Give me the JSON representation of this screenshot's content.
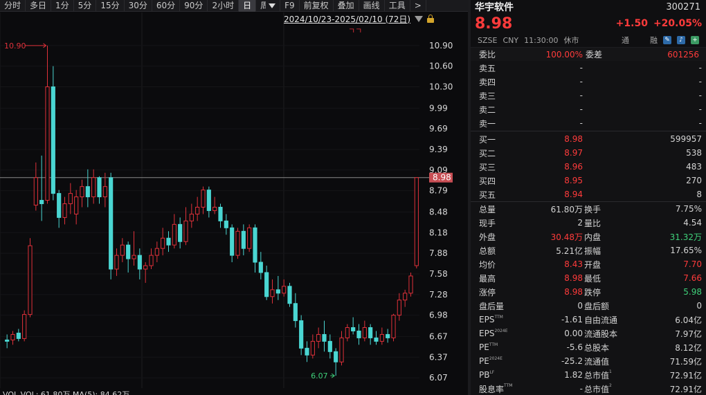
{
  "toolbar": {
    "items": [
      "分时",
      "多日",
      "1分",
      "5分",
      "15分",
      "30分",
      "60分",
      "90分",
      "2小时",
      "日",
      "周",
      "F9",
      "前复权",
      "叠加",
      "画线",
      "工具",
      ">"
    ],
    "active_index": 9
  },
  "chart": {
    "range": "2024/10/23-2025/02/10 (72日)",
    "price_labels": [
      "10.90",
      "10.60",
      "10.30",
      "9.99",
      "9.69",
      "9.39",
      "9.09",
      "8.79",
      "8.48",
      "8.18",
      "7.88",
      "7.58",
      "7.28",
      "6.98",
      "6.67",
      "6.37",
      "6.07"
    ],
    "current_price_tag": "8.98",
    "high_marker": "10.90",
    "low_marker": "6.07",
    "limit_up_marker": "ㄱㄱ",
    "bottom_text": "VOL    VOL: 61.80万    MA(5): 84.62万",
    "colors": {
      "up": "#e0313a",
      "down": "#4ad6d2",
      "background": "#0b0b0d"
    }
  },
  "chart_data": {
    "type": "candlestick",
    "ylim": [
      5.9,
      11.2
    ],
    "candles": [
      [
        6.62,
        6.6,
        6.7,
        6.5
      ],
      [
        6.62,
        6.7,
        6.75,
        6.55
      ],
      [
        6.72,
        6.64,
        6.78,
        6.6
      ],
      [
        6.64,
        6.99,
        7.05,
        6.6
      ],
      [
        6.99,
        7.99,
        8.1,
        6.95
      ],
      [
        8.58,
        8.98,
        9.2,
        8.5
      ],
      [
        8.65,
        8.6,
        9.3,
        8.35
      ],
      [
        8.65,
        10.3,
        10.9,
        8.6
      ],
      [
        10.3,
        8.75,
        10.6,
        8.65
      ],
      [
        8.75,
        8.4,
        8.8,
        8.25
      ],
      [
        8.4,
        8.6,
        8.7,
        8.3
      ],
      [
        8.6,
        8.75,
        8.9,
        8.45
      ],
      [
        8.45,
        8.7,
        8.8,
        8.3
      ],
      [
        8.7,
        8.85,
        8.95,
        8.55
      ],
      [
        8.85,
        8.7,
        9.1,
        8.55
      ],
      [
        8.7,
        8.98,
        9.1,
        8.6
      ],
      [
        8.98,
        8.7,
        9.0,
        8.6
      ],
      [
        8.7,
        8.85,
        9.05,
        8.55
      ],
      [
        8.98,
        7.65,
        9.05,
        7.5
      ],
      [
        7.65,
        7.85,
        7.95,
        7.55
      ],
      [
        7.85,
        8.0,
        8.1,
        7.75
      ],
      [
        8.0,
        7.8,
        8.05,
        7.6
      ],
      [
        7.8,
        7.85,
        8.2,
        7.7
      ],
      [
        7.85,
        7.65,
        7.95,
        7.5
      ],
      [
        7.65,
        7.7,
        7.75,
        7.45
      ],
      [
        7.7,
        7.85,
        7.95,
        7.65
      ],
      [
        7.85,
        7.95,
        8.05,
        7.75
      ],
      [
        7.95,
        8.1,
        8.25,
        7.85
      ],
      [
        8.1,
        8.0,
        8.2,
        7.9
      ],
      [
        8.0,
        8.3,
        8.45,
        7.95
      ],
      [
        8.3,
        8.05,
        8.4,
        7.95
      ],
      [
        8.05,
        8.35,
        8.55,
        8.0
      ],
      [
        8.35,
        8.45,
        8.6,
        8.25
      ],
      [
        8.45,
        8.55,
        8.7,
        8.35
      ],
      [
        8.55,
        8.8,
        8.85,
        8.45
      ],
      [
        8.8,
        8.5,
        8.85,
        8.4
      ],
      [
        8.5,
        8.55,
        8.7,
        8.45
      ],
      [
        8.55,
        8.35,
        8.6,
        8.25
      ],
      [
        8.35,
        8.25,
        8.45,
        8.15
      ],
      [
        8.25,
        7.85,
        8.3,
        7.75
      ],
      [
        7.85,
        8.2,
        8.25,
        7.8
      ],
      [
        8.2,
        7.95,
        8.3,
        7.85
      ],
      [
        7.95,
        8.25,
        8.3,
        7.9
      ],
      [
        8.25,
        7.75,
        8.3,
        7.6
      ],
      [
        7.75,
        7.6,
        7.9,
        7.5
      ],
      [
        7.6,
        7.25,
        7.7,
        7.2
      ],
      [
        7.25,
        7.35,
        7.5,
        7.15
      ],
      [
        7.35,
        7.3,
        7.55,
        7.2
      ],
      [
        7.3,
        7.4,
        7.5,
        7.25
      ],
      [
        7.4,
        7.15,
        7.45,
        7.1
      ],
      [
        7.15,
        6.9,
        7.3,
        6.8
      ],
      [
        6.9,
        6.5,
        6.98,
        6.4
      ],
      [
        6.5,
        6.4,
        6.6,
        6.3
      ],
      [
        6.4,
        6.6,
        6.7,
        6.35
      ],
      [
        6.6,
        6.7,
        6.8,
        6.5
      ],
      [
        6.7,
        6.6,
        6.9,
        6.45
      ],
      [
        6.6,
        6.45,
        6.7,
        6.35
      ],
      [
        6.45,
        6.3,
        6.5,
        6.1
      ],
      [
        6.3,
        6.65,
        6.75,
        6.25
      ],
      [
        6.65,
        6.8,
        6.85,
        6.6
      ],
      [
        6.8,
        6.75,
        6.95,
        6.7
      ],
      [
        6.75,
        6.65,
        6.85,
        6.55
      ],
      [
        6.65,
        6.8,
        6.9,
        6.6
      ],
      [
        6.8,
        6.65,
        6.85,
        6.55
      ],
      [
        6.65,
        6.6,
        6.75,
        6.55
      ],
      [
        6.6,
        6.7,
        6.8,
        6.55
      ],
      [
        6.7,
        6.65,
        6.78,
        6.58
      ],
      [
        6.65,
        6.98,
        7.0,
        6.6
      ],
      [
        6.98,
        7.2,
        7.3,
        6.9
      ],
      [
        7.2,
        7.3,
        7.35,
        7.1
      ],
      [
        7.3,
        7.55,
        7.6,
        7.25
      ],
      [
        7.7,
        8.98,
        8.98,
        7.66
      ]
    ]
  },
  "quote": {
    "name": "华宇软件",
    "code": "300271",
    "price": "8.98",
    "change": "+1.50",
    "change_pct": "+20.05%",
    "meta": {
      "exchange": "SZSE",
      "currency": "CNY",
      "time": "11:30:00",
      "status": "休市",
      "tong": "通",
      "rong": "融"
    },
    "wei": {
      "label1": "委比",
      "value1": "100.00%",
      "label2": "委差",
      "value2": "601256"
    },
    "asks": [
      {
        "label": "卖五",
        "price": "-",
        "vol": "-"
      },
      {
        "label": "卖四",
        "price": "-",
        "vol": "-"
      },
      {
        "label": "卖三",
        "price": "-",
        "vol": "-"
      },
      {
        "label": "卖二",
        "price": "-",
        "vol": "-"
      },
      {
        "label": "卖一",
        "price": "-",
        "vol": "-"
      }
    ],
    "bids": [
      {
        "label": "买一",
        "price": "8.98",
        "vol": "599957"
      },
      {
        "label": "买二",
        "price": "8.97",
        "vol": "538"
      },
      {
        "label": "买三",
        "price": "8.96",
        "vol": "483"
      },
      {
        "label": "买四",
        "price": "8.95",
        "vol": "270"
      },
      {
        "label": "买五",
        "price": "8.94",
        "vol": "8"
      }
    ],
    "stats": [
      {
        "k1": "总量",
        "v1": "61.80万",
        "k2": "换手",
        "v2": "7.75%",
        "c1": "",
        "c2": ""
      },
      {
        "k1": "现手",
        "v1": "2",
        "k2": "量比",
        "v2": "4.54",
        "c1": "",
        "c2": ""
      },
      {
        "k1": "外盘",
        "v1": "30.48万",
        "k2": "内盘",
        "v2": "31.32万",
        "c1": "red",
        "c2": "green"
      },
      {
        "k1": "总额",
        "v1": "5.21亿",
        "k2": "振幅",
        "v2": "17.65%",
        "c1": "",
        "c2": ""
      },
      {
        "k1": "均价",
        "v1": "8.43",
        "k2": "开盘",
        "v2": "7.70",
        "c1": "red",
        "c2": "red"
      },
      {
        "k1": "最高",
        "v1": "8.98",
        "k2": "最低",
        "v2": "7.66",
        "c1": "red",
        "c2": "red"
      },
      {
        "k1": "涨停",
        "v1": "8.98",
        "k2": "跌停",
        "v2": "5.98",
        "c1": "red",
        "c2": "green"
      },
      {
        "k1": "盘后量",
        "v1": "0",
        "k2": "盘后额",
        "v2": "0",
        "c1": "",
        "c2": ""
      },
      {
        "k1": "EPS",
        "sup1": "TTM",
        "v1": "-1.61",
        "k2": "自由流通",
        "v2": "6.04亿",
        "c1": "",
        "c2": ""
      },
      {
        "k1": "EPS",
        "sup1": "2024E",
        "v1": "0.00",
        "k2": "流通股本",
        "v2": "7.97亿",
        "c1": "",
        "c2": ""
      },
      {
        "k1": "PE",
        "sup1": "TTM",
        "v1": "-5.6",
        "k2": "总股本",
        "v2": "8.12亿",
        "c1": "",
        "c2": ""
      },
      {
        "k1": "PE",
        "sup1": "2024E",
        "v1": "-25.2",
        "k2": "流通值",
        "v2": "71.59亿",
        "c1": "",
        "c2": ""
      },
      {
        "k1": "PB",
        "sup1": "LF",
        "v1": "1.82",
        "k2": "总市值",
        "sup2": "1",
        "v2": "72.91亿",
        "c1": "",
        "c2": ""
      },
      {
        "k1": "股息率",
        "sup1": "TTM",
        "v1": "-",
        "k2": "总市值",
        "sup2": "2",
        "v2": "72.91亿",
        "c1": "",
        "c2": ""
      }
    ]
  }
}
